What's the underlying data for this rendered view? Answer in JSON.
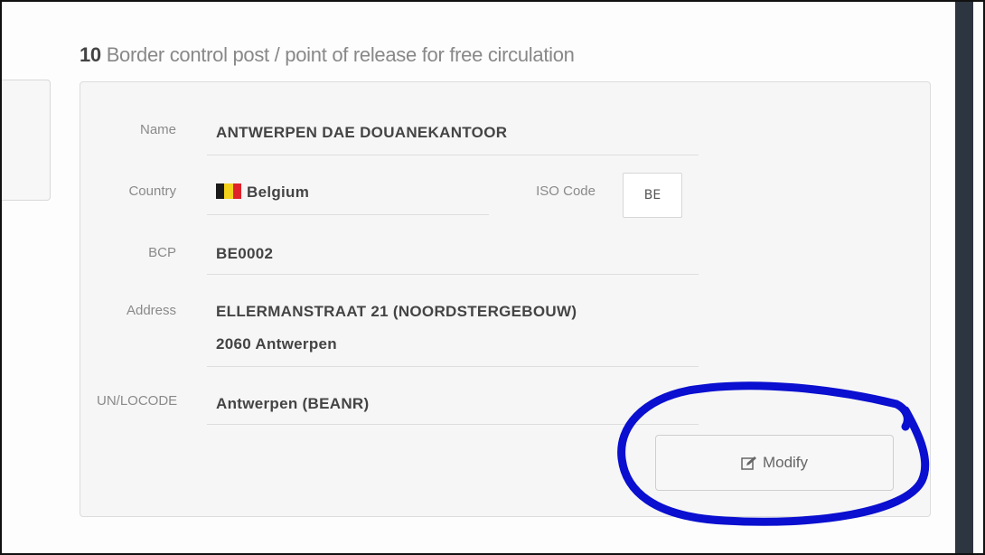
{
  "section": {
    "number": "10",
    "title": "Border control post / point of release for free circulation"
  },
  "fields": {
    "name": {
      "label": "Name",
      "value": "ANTWERPEN DAE DOUANEKANTOOR"
    },
    "country": {
      "label": "Country",
      "value": "Belgium",
      "flag_colors": [
        "#1a1a1a",
        "#f3d21b",
        "#e0232b"
      ]
    },
    "iso": {
      "label": "ISO Code",
      "value": "BE"
    },
    "bcp": {
      "label": "BCP",
      "value": "BE0002"
    },
    "address": {
      "label": "Address",
      "line1": "ELLERMANSTRAAT 21 (NOORDSTERGEBOUW)",
      "line2": "2060 Antwerpen"
    },
    "unlocode": {
      "label": "UN/LOCODE",
      "value": "Antwerpen (BEANR)"
    }
  },
  "actions": {
    "modify_label": "Modify",
    "modify_icon": "edit-icon"
  },
  "annotation": {
    "color": "#0a0fd0"
  }
}
